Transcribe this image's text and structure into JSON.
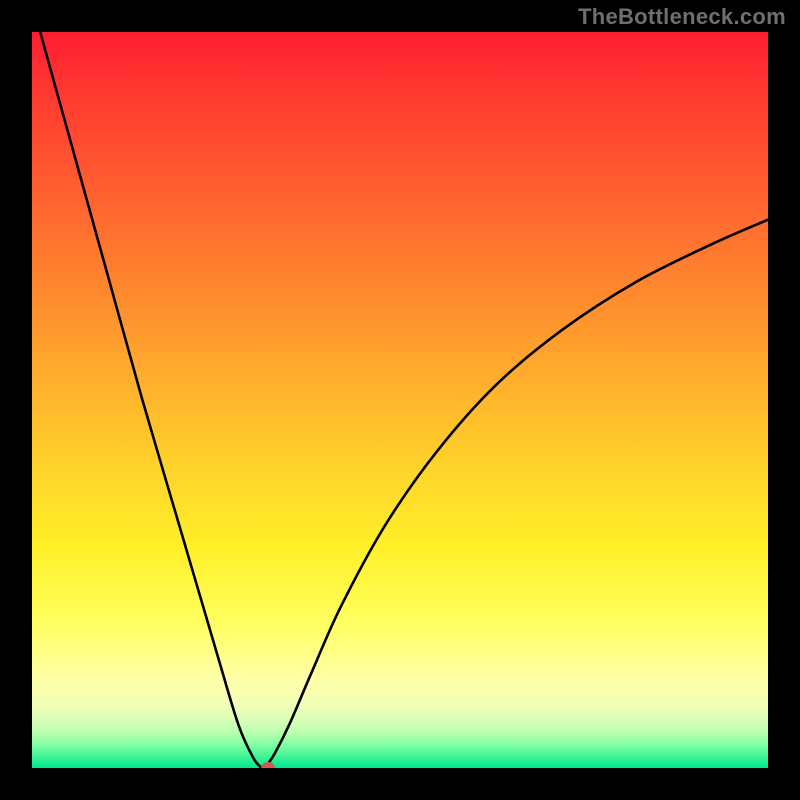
{
  "watermark": "TheBottleneck.com",
  "chart_data": {
    "type": "line",
    "title": "",
    "xlabel": "",
    "ylabel": "",
    "xlim": [
      0,
      100
    ],
    "ylim": [
      0,
      100
    ],
    "series": [
      {
        "name": "curve",
        "x": [
          0,
          5,
          10,
          15,
          20,
          25,
          28,
          30,
          31,
          31.5,
          32,
          33,
          35,
          38,
          42,
          48,
          55,
          63,
          72,
          82,
          92,
          100
        ],
        "y": [
          104,
          86,
          68,
          50,
          33,
          16,
          6,
          1.5,
          0.2,
          0,
          0.5,
          2,
          6,
          13,
          22,
          33,
          43,
          52,
          59.5,
          66,
          71,
          74.5
        ]
      }
    ],
    "marker": {
      "x": 32,
      "y": 0
    },
    "background_gradient": {
      "top": "#ff1d31",
      "bottom": "#00e98c"
    }
  }
}
